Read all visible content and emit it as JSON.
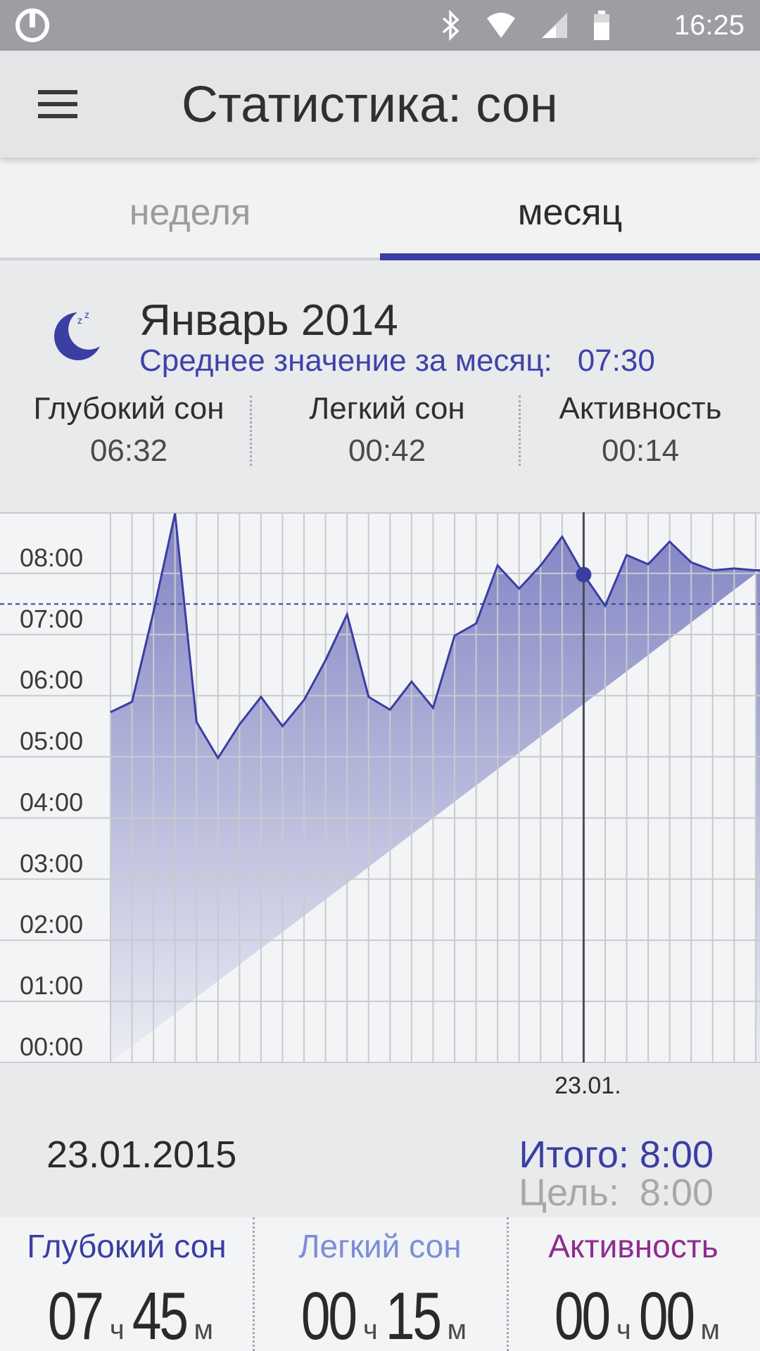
{
  "status_bar": {
    "time": "16:25",
    "icons": [
      "app-logo-icon",
      "bluetooth-icon",
      "wifi-icon",
      "signal-icon",
      "battery-icon"
    ],
    "background_color": "#9c9ea2"
  },
  "app_bar": {
    "title": "Статистика: сон",
    "menu_icon": "hamburger-menu-icon"
  },
  "tabs": [
    {
      "label": "неделя",
      "selected": false
    },
    {
      "label": "месяц",
      "selected": true
    }
  ],
  "accent_color": "#3a3ea3",
  "summary": {
    "icon": "moon-sleep-icon",
    "month_title": "Январь 2014",
    "average_label": "Среднее значение за месяц:",
    "average_value": "07:30",
    "stats": [
      {
        "label": "Глубокий сон",
        "value": "06:32"
      },
      {
        "label": "Легкий сон",
        "value": "00:42"
      },
      {
        "label": "Активность",
        "value": "00:14"
      }
    ]
  },
  "chart_data": {
    "type": "area",
    "x": [
      1,
      2,
      3,
      4,
      5,
      6,
      7,
      8,
      9,
      10,
      11,
      12,
      13,
      14,
      15,
      16,
      17,
      18,
      19,
      20,
      21,
      22,
      23,
      24,
      25,
      26,
      27,
      28,
      29,
      30,
      31
    ],
    "values": [
      5.73,
      5.9,
      7.37,
      8.98,
      5.57,
      4.98,
      5.53,
      5.98,
      5.5,
      5.93,
      6.58,
      7.33,
      5.98,
      5.77,
      6.23,
      5.8,
      6.98,
      7.18,
      8.13,
      7.75,
      8.13,
      8.6,
      7.98,
      7.47,
      8.3,
      8.15,
      8.52,
      8.18,
      8.05,
      8.08,
      8.05
    ],
    "yticks": [
      "00:00",
      "01:00",
      "02:00",
      "03:00",
      "04:00",
      "05:00",
      "06:00",
      "07:00",
      "08:00"
    ],
    "ylim": [
      0,
      9
    ],
    "average_line": 7.5,
    "selected_day": 23,
    "selected_label": "23.01.",
    "grid": true,
    "fill_color": "#3a3ea3",
    "line_color": "#3a3ea3"
  },
  "detail": {
    "date": "23.01.2015",
    "total_label": "Итого:",
    "total_value": "8:00",
    "goal_label": "Цель:",
    "goal_value": "8:00",
    "columns": [
      {
        "label": "Глубокий сон",
        "color": "#3a3ea3",
        "hours": "07",
        "hours_unit": "ч",
        "minutes": "45",
        "minutes_unit": "м"
      },
      {
        "label": "Легкий сон",
        "color": "#7b8fd6",
        "hours": "00",
        "hours_unit": "ч",
        "minutes": "15",
        "minutes_unit": "м"
      },
      {
        "label": "Активность",
        "color": "#8e2c8e",
        "hours": "00",
        "hours_unit": "ч",
        "minutes": "00",
        "minutes_unit": "м"
      }
    ]
  }
}
